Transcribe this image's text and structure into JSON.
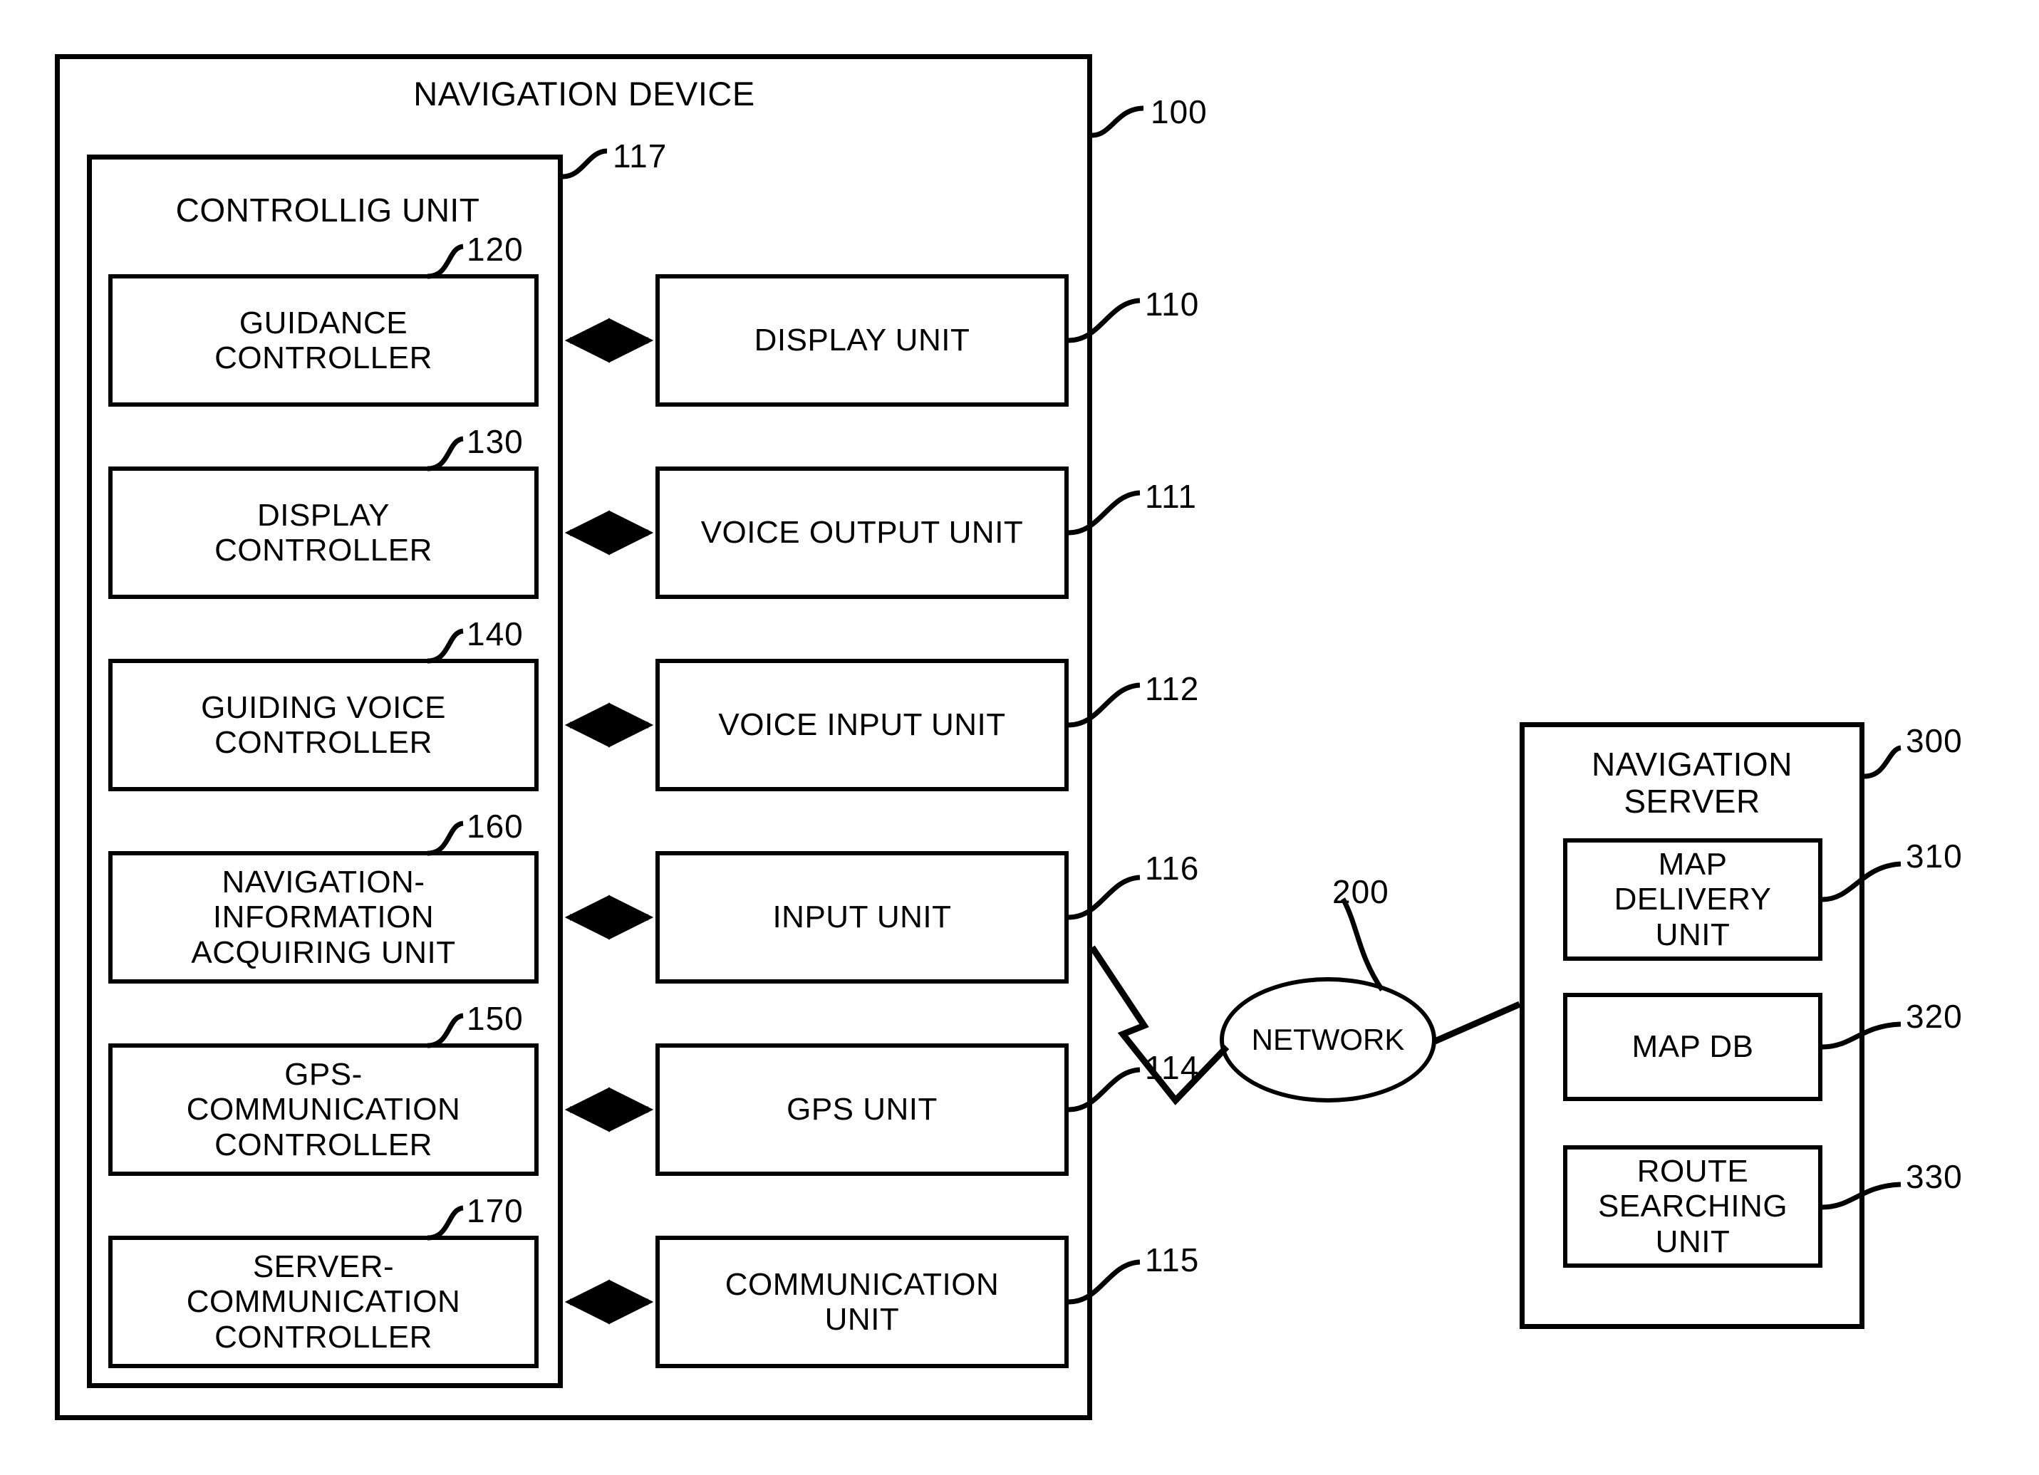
{
  "figure": {
    "type": "patent-block-diagram",
    "device": {
      "title": "NAVIGATION DEVICE",
      "ref": "100",
      "controlling_unit": {
        "title": "CONTROLLIG UNIT",
        "ref": "117",
        "blocks": [
          {
            "label": "GUIDANCE\nCONTROLLER",
            "ref": "120"
          },
          {
            "label": "DISPLAY\nCONTROLLER",
            "ref": "130"
          },
          {
            "label": "GUIDING VOICE\nCONTROLLER",
            "ref": "140"
          },
          {
            "label": "NAVIGATION-\nINFORMATION\nACQUIRING UNIT",
            "ref": "160"
          },
          {
            "label": "GPS-\nCOMMUNICATION\nCONTROLLER",
            "ref": "150"
          },
          {
            "label": "SERVER-\nCOMMUNICATION\nCONTROLLER",
            "ref": "170"
          }
        ]
      },
      "peripherals": [
        {
          "label": "DISPLAY UNIT",
          "ref": "110"
        },
        {
          "label": "VOICE OUTPUT UNIT",
          "ref": "111"
        },
        {
          "label": "VOICE INPUT UNIT",
          "ref": "112"
        },
        {
          "label": "INPUT UNIT",
          "ref": "116"
        },
        {
          "label": "GPS UNIT",
          "ref": "114"
        },
        {
          "label": "COMMUNICATION\nUNIT",
          "ref": "115"
        }
      ]
    },
    "network": {
      "label": "NETWORK",
      "ref": "200"
    },
    "server": {
      "title": "NAVIGATION\nSERVER",
      "ref": "300",
      "blocks": [
        {
          "label": "MAP\nDELIVERY\nUNIT",
          "ref": "310"
        },
        {
          "label": "MAP DB",
          "ref": "320"
        },
        {
          "label": "ROUTE\nSEARCHING\nUNIT",
          "ref": "330"
        }
      ]
    },
    "connectors": {
      "bidirectional_arrow_count": 6,
      "lightning_link": "wireless-link-between-navigation-device-and-network",
      "network_to_server_line": "line"
    },
    "colors": {
      "stroke": "#000000",
      "background": "#ffffff"
    }
  }
}
